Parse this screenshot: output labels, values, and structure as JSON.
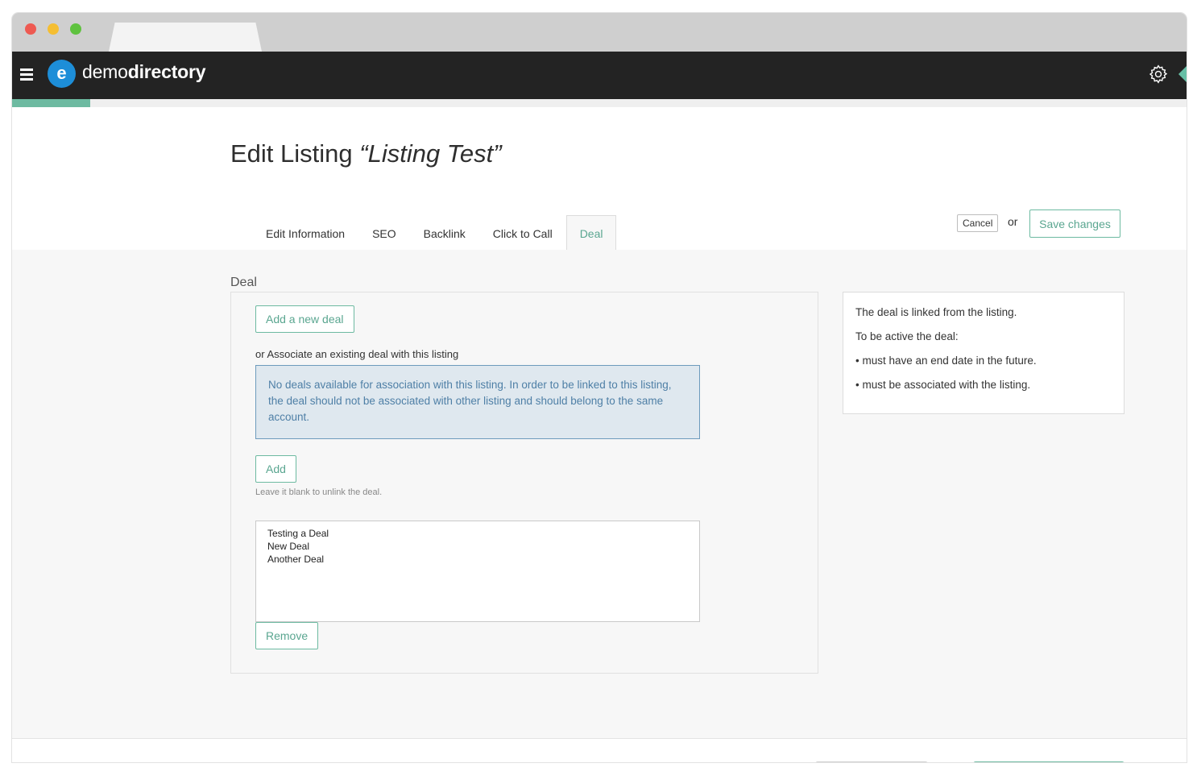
{
  "brand": {
    "logo_letter": "e",
    "name_light": "demo",
    "name_bold": "directory"
  },
  "colors": {
    "accent": "#5aa690",
    "navbar": "#232323",
    "logo_blue": "#1d8ed8",
    "alert_bg": "#dfe8ef",
    "alert_text": "#4e7fa6"
  },
  "header": {
    "title_prefix": "Edit Listing ",
    "listing_name": "“Listing Test”",
    "cancel_label": "Cancel",
    "or_label": "or",
    "save_label": "Save changes"
  },
  "tabs": [
    {
      "label": "Edit Information",
      "active": false
    },
    {
      "label": "SEO",
      "active": false
    },
    {
      "label": "Backlink",
      "active": false
    },
    {
      "label": "Click to Call",
      "active": false
    },
    {
      "label": "Deal",
      "active": true
    }
  ],
  "deal": {
    "section_title": "Deal",
    "add_new_label": "Add a new deal",
    "associate_label": "or Associate an existing deal with this listing",
    "alert_text": "No deals available for association with this listing. In order to be linked to this listing, the deal should not be associated with other listing and should belong to the same account.",
    "add_label": "Add",
    "hint": "Leave it blank to unlink the deal.",
    "items": [
      "Testing a Deal",
      "New Deal",
      "Another Deal"
    ],
    "remove_label": "Remove"
  },
  "info": {
    "line1": "The deal is linked from the listing.",
    "line2": "To be active the deal:",
    "line3": "• must have an end date in the future.",
    "line4": "• must be associated with the listing."
  },
  "icons": {
    "menu": "hamburger-icon",
    "settings": "gear-icon"
  }
}
